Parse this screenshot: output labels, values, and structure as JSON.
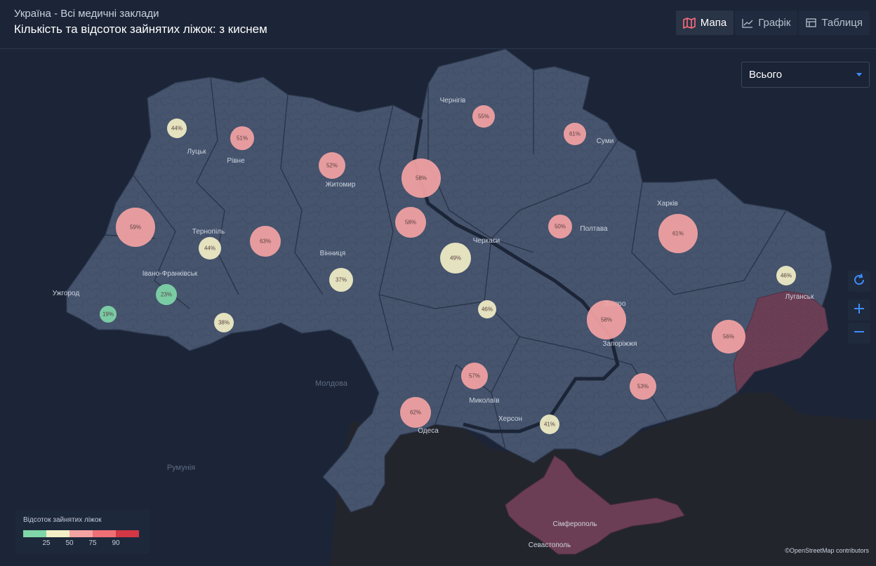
{
  "header": {
    "subtitle": "Україна - Всі медичні заклади",
    "title": "Кількість та відсоток зайнятих ліжок: з киснем"
  },
  "tabs": [
    {
      "label": "Мапа",
      "icon": "map-icon",
      "active": true
    },
    {
      "label": "Графік",
      "icon": "line-chart-icon",
      "active": false
    },
    {
      "label": "Таблиця",
      "icon": "table-icon",
      "active": false
    }
  ],
  "filter": {
    "selected": "Всього"
  },
  "controls": {
    "refresh": "refresh-icon",
    "zoom_in": "+",
    "zoom_out": "−"
  },
  "legend": {
    "title": "Відсоток зайнятих ліжок",
    "ticks": [
      "25",
      "50",
      "75",
      "90"
    ],
    "colors": [
      "#7fd6a8",
      "#f2efc6",
      "#f4a3a3",
      "#ee6f76",
      "#d23845"
    ]
  },
  "attribution": "©OpenStreetMap contributors",
  "countries": [
    "Молдова",
    "Румунія"
  ],
  "cities": [
    "Ужгород",
    "Луцьк",
    "Рівне",
    "Тернопіль",
    "Івано-Франківськ",
    "Житомир",
    "Вінниця",
    "Чернігів",
    "Суми",
    "Черкаси",
    "Полтава",
    "Харків",
    "Луганськ",
    "Дніпро",
    "Запоріжжя",
    "Миколаїв",
    "Херсон",
    "Одеса",
    "Сімферополь",
    "Севастополь"
  ],
  "bubbles": [
    {
      "label": "44%",
      "value": 44
    },
    {
      "label": "51%",
      "value": 51
    },
    {
      "label": "52%",
      "value": 52
    },
    {
      "label": "58%",
      "value": 58
    },
    {
      "label": "55%",
      "value": 55
    },
    {
      "label": "61%",
      "value": 61
    },
    {
      "label": "59%",
      "value": 59
    },
    {
      "label": "44%",
      "value": 44
    },
    {
      "label": "63%",
      "value": 63
    },
    {
      "label": "58%",
      "value": 58
    },
    {
      "label": "50%",
      "value": 50
    },
    {
      "label": "61%",
      "value": 61
    },
    {
      "label": "49%",
      "value": 49
    },
    {
      "label": "37%",
      "value": 37
    },
    {
      "label": "23%",
      "value": 23
    },
    {
      "label": "19%",
      "value": 19
    },
    {
      "label": "38%",
      "value": 38
    },
    {
      "label": "46%",
      "value": 46
    },
    {
      "label": "46%",
      "value": 46
    },
    {
      "label": "58%",
      "value": 58
    },
    {
      "label": "56%",
      "value": 56
    },
    {
      "label": "57%",
      "value": 57
    },
    {
      "label": "53%",
      "value": 53
    },
    {
      "label": "62%",
      "value": 62
    },
    {
      "label": "41%",
      "value": 41
    }
  ]
}
